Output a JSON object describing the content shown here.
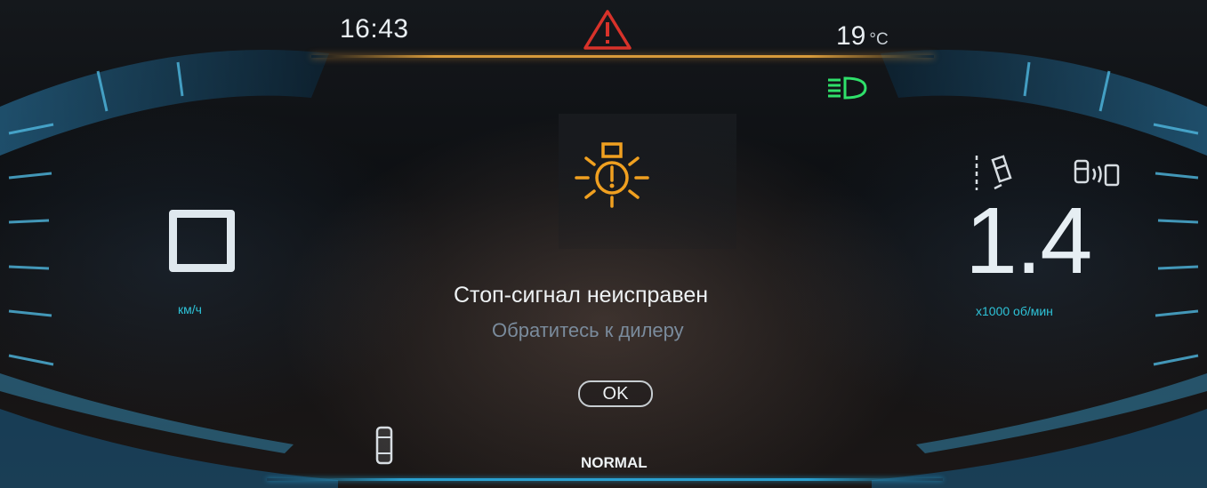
{
  "status_bar": {
    "time": "16:43",
    "temperature_value": "19",
    "temperature_unit": "°C",
    "master_warning_icon": "warning-triangle-icon",
    "headlight_icon": "low-beam-headlight-icon"
  },
  "speedometer": {
    "value": "0",
    "unit": "км/ч"
  },
  "tachometer": {
    "value": "1.4",
    "unit": "x1000 об/мин",
    "icons": [
      "lane-keep-assist-icon",
      "parking-sensor-icon"
    ]
  },
  "alert": {
    "icon": "brake-light-fault-icon",
    "title": "Стоп-сигнал неисправен",
    "subtitle": "Обратитесь к дилеру",
    "confirm_label": "OK"
  },
  "drive_mode": {
    "label": "NORMAL",
    "icon": "car-door-icon"
  },
  "colors": {
    "accent_cyan": "#2ec3d8",
    "warning_amber": "#f0a020",
    "warning_red": "#d8322a",
    "headlight_green": "#2fe06a"
  }
}
